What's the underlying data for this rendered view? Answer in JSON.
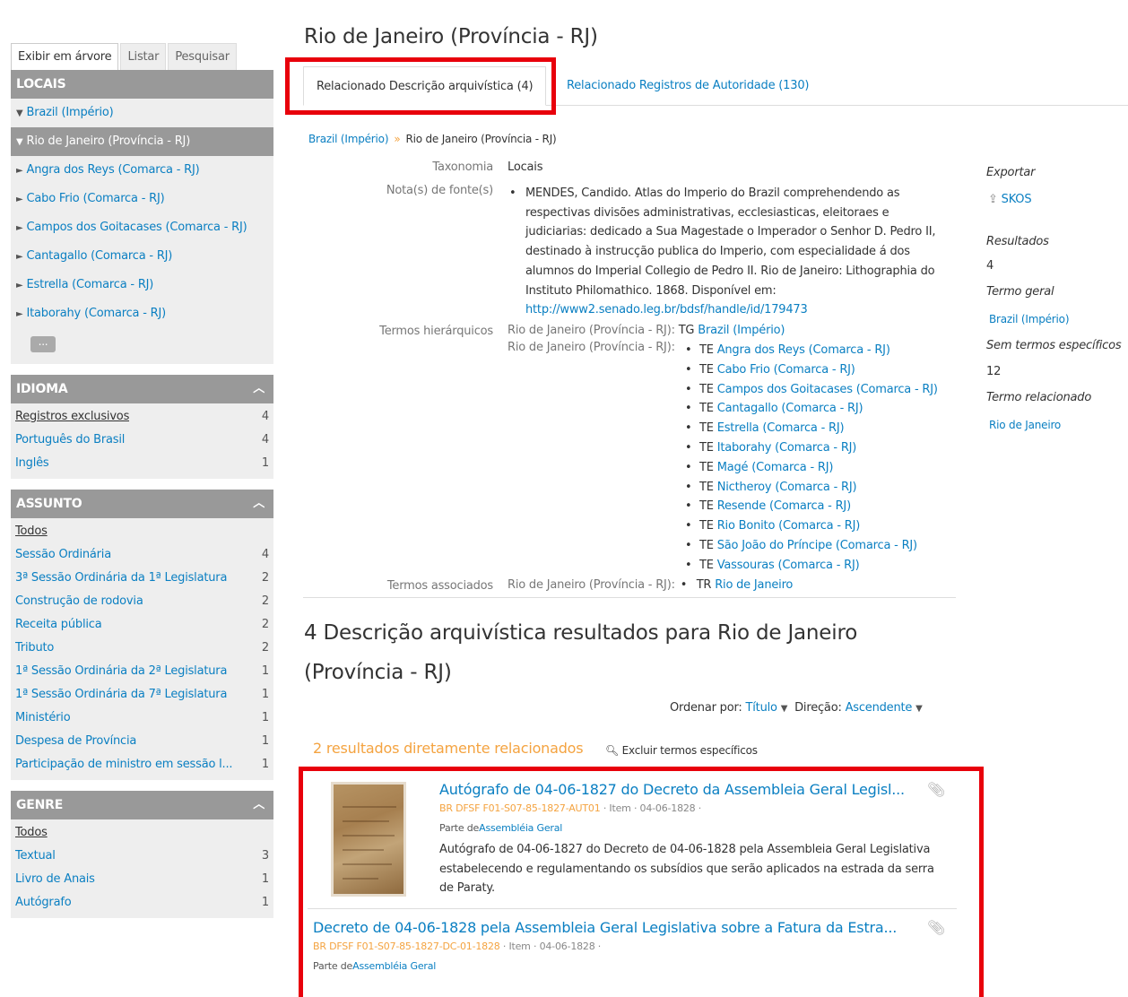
{
  "sidebar": {
    "tabs": [
      "Exibir em árvore",
      "Listar",
      "Pesquisar"
    ],
    "locais_heading": "LOCAIS",
    "tree": [
      {
        "label": "Brazil (Império)",
        "marker": "▼",
        "selected": false
      },
      {
        "label": "Rio de Janeiro (Província - RJ)",
        "marker": "▼",
        "selected": true
      },
      {
        "label": "Angra dos Reys (Comarca - RJ)",
        "marker": "►"
      },
      {
        "label": "Cabo Frio (Comarca - RJ)",
        "marker": "►"
      },
      {
        "label": "Campos dos Goitacases (Comarca - RJ)",
        "marker": "►"
      },
      {
        "label": "Cantagallo (Comarca - RJ)",
        "marker": "►"
      },
      {
        "label": "Estrella (Comarca - RJ)",
        "marker": "►"
      },
      {
        "label": "Itaborahy (Comarca - RJ)",
        "marker": "►"
      }
    ],
    "more_label": "...",
    "idioma": {
      "heading": "IDIOMA",
      "rows": [
        {
          "label": "Registros exclusivos",
          "count": "4"
        },
        {
          "label": "Português do Brasil",
          "count": "4"
        },
        {
          "label": "Inglês",
          "count": "1"
        }
      ]
    },
    "assunto": {
      "heading": "ASSUNTO",
      "rows": [
        {
          "label": "Todos",
          "count": ""
        },
        {
          "label": "Sessão Ordinária",
          "count": "4"
        },
        {
          "label": "3ª Sessão Ordinária da 1ª Legislatura",
          "count": "2"
        },
        {
          "label": "Construção de rodovia",
          "count": "2"
        },
        {
          "label": "Receita pública",
          "count": "2"
        },
        {
          "label": "Tributo",
          "count": "2"
        },
        {
          "label": "1ª Sessão Ordinária da 2ª Legislatura",
          "count": "1"
        },
        {
          "label": "1ª Sessão Ordinária da 7ª Legislatura",
          "count": "1"
        },
        {
          "label": "Ministério",
          "count": "1"
        },
        {
          "label": "Despesa de Província",
          "count": "1"
        },
        {
          "label": "Participação de ministro em sessão l...",
          "count": "1"
        }
      ]
    },
    "genre": {
      "heading": "GENRE",
      "rows": [
        {
          "label": "Todos",
          "count": ""
        },
        {
          "label": "Textual",
          "count": "3"
        },
        {
          "label": "Livro de Anais",
          "count": "1"
        },
        {
          "label": "Autógrafo",
          "count": "1"
        }
      ]
    }
  },
  "main": {
    "title": "Rio de Janeiro (Província - RJ)",
    "tab_archival": "Relacionado Descrição arquivística (4)",
    "tab_authority": "Relacionado Registros de Autoridade (130)",
    "breadcrumb": {
      "parent": "Brazil (Império)",
      "sep": "»",
      "current": "Rio de Janeiro (Província - RJ)"
    },
    "fields": {
      "taxonomy_label": "Taxonomia",
      "taxonomy_value": "Locais",
      "source_label": "Nota(s) de fonte(s)",
      "source_text": "MENDES, Candido. Atlas do Imperio do Brazil comprehendendo as respectivas divisões administrativas, ecclesiasticas, eleitoraes e judiciarias: dedicado a Sua Magestade o Imperador o Senhor D. Pedro II, destinado à instrucção publica do Imperio, com especialidade á dos alumnos do Imperial Collegio de Pedro II. Rio de Janeiro: Lithographia do Instituto Philomathico. 1868. Disponível em:",
      "source_link": "http://www2.senado.leg.br/bdsf/handle/id/179473",
      "hier_label": "Termos hierárquicos",
      "hier_prefix": "Rio de Janeiro (Província - RJ):",
      "tg_code": "TG",
      "tg_link": "Brazil (Império)",
      "te_code": "TE",
      "te_items": [
        "Angra dos Reys (Comarca - RJ)",
        "Cabo Frio (Comarca - RJ)",
        "Campos dos Goitacases (Comarca - RJ)",
        "Cantagallo (Comarca - RJ)",
        "Estrella (Comarca - RJ)",
        "Itaborahy (Comarca - RJ)",
        "Magé (Comarca - RJ)",
        "Nictheroy (Comarca - RJ)",
        "Resende (Comarca - RJ)",
        "Rio Bonito (Comarca - RJ)",
        "São João do Príncipe (Comarca - RJ)",
        "Vassouras (Comarca - RJ)"
      ],
      "assoc_label": "Termos associados",
      "tr_code": "TR",
      "tr_link": "Rio de Janeiro"
    },
    "right": {
      "export_heading": "Exportar",
      "skos_label": "SKOS",
      "results_heading": "Resultados",
      "results_value": "4",
      "broader_heading": "Termo geral",
      "broader_value": "Brazil (Império)",
      "narrower_heading": "Sem termos específicos",
      "narrower_value": "12",
      "related_heading": "Termo relacionado",
      "related_value": "Rio de Janeiro"
    },
    "results_heading": "4 Descrição arquivística resultados para Rio de Janeiro (Província - RJ)",
    "sort": {
      "label": "Ordenar por:",
      "value": "Título",
      "dir_label": "Direção:",
      "dir_value": "Ascendente"
    },
    "direct_results": "2 resultados diretamente relacionados",
    "exclude_label": "Excluir termos específicos",
    "results": [
      {
        "title": "Autógrafo de 04-06-1827 do Decreto da Assembleia Geral Legisl...",
        "ref": "BR DFSF F01-S07-85-1827-AUT01",
        "meta": " · Item · 04-06-1828 ·",
        "part_prefix": "Parte de",
        "part_link": "Assembléia Geral",
        "description": "Autógrafo de 04-06-1827 do Decreto de 04-06-1828 pela Assembleia Geral Legislativa estabelecendo e regulamentando os subsídios que serão aplicados na estrada da serra de Paraty."
      },
      {
        "title": "Decreto de 04-06-1828 pela Assembleia Geral Legislativa sobre a Fatura da Estra...",
        "ref": "BR DFSF F01-S07-85-1827-DC-01-1828",
        "meta": " · Item · 04-06-1828 ·",
        "part_prefix": "Parte de",
        "part_link": "Assembléia Geral"
      }
    ]
  },
  "colors": {
    "link": "#0a7fc2",
    "accent": "#f4a340",
    "highlight_box": "#e8000b",
    "facet_head": "#999999"
  }
}
